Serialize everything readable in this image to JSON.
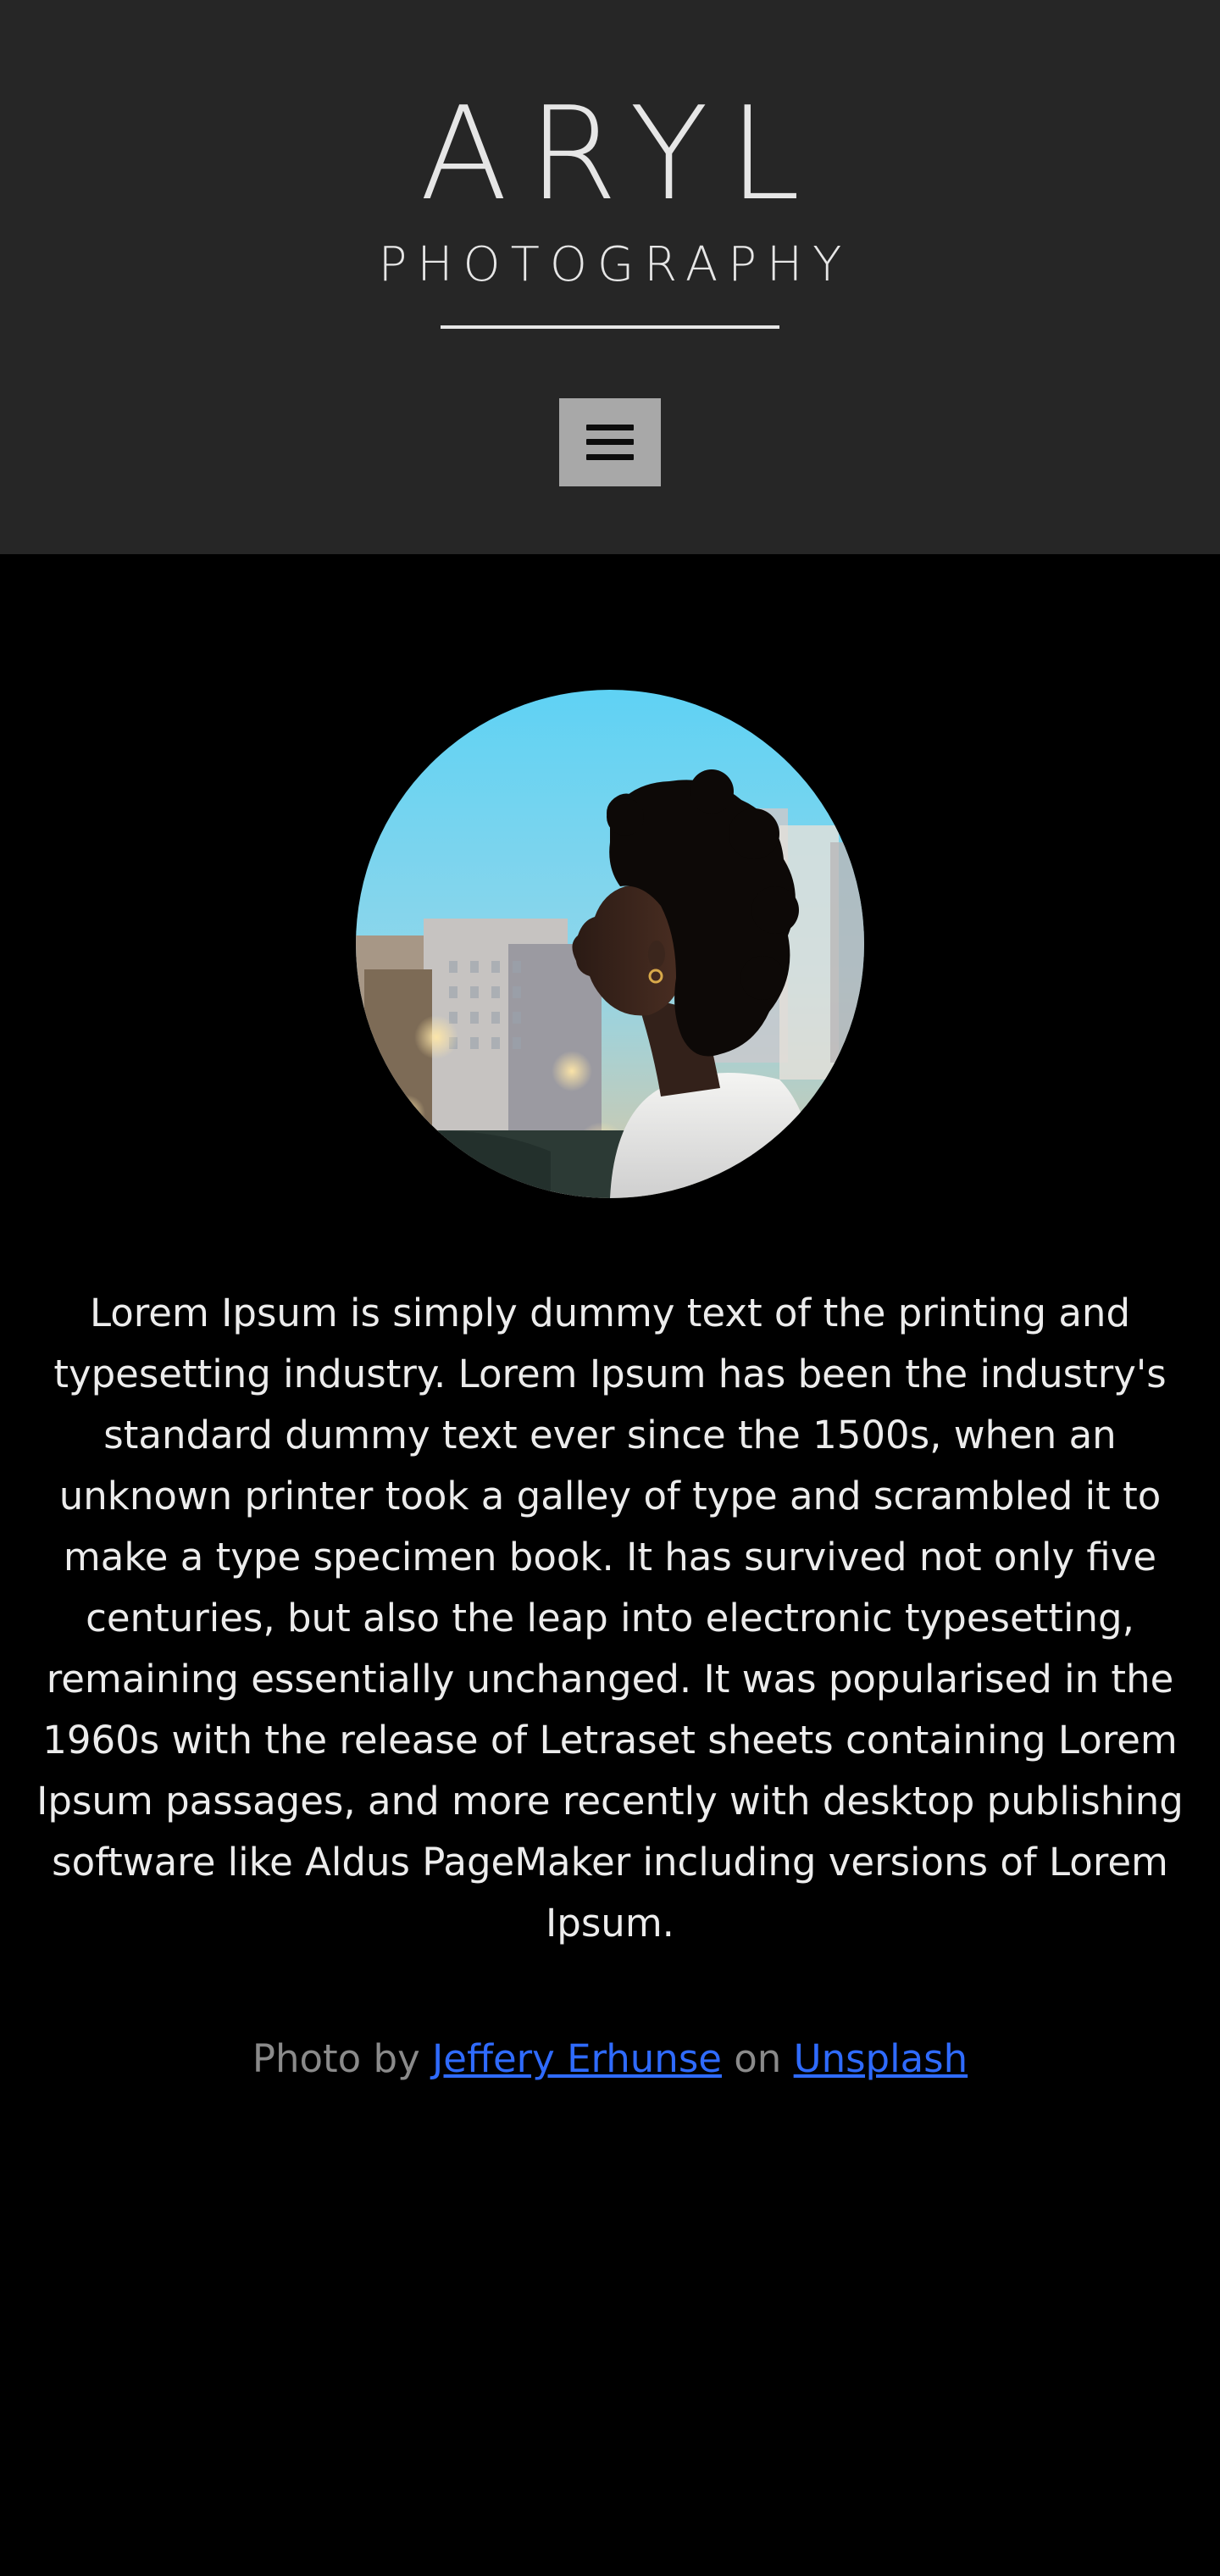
{
  "header": {
    "title": "ARYL",
    "subtitle": "PHOTOGRAPHY",
    "menu_icon": "hamburger-icon",
    "background_color": "#262626",
    "text_color": "#e6e6e6"
  },
  "main": {
    "portrait_alt": "",
    "bio": "Lorem Ipsum is simply dummy text of the printing and typesetting industry. Lorem Ipsum has been the industry's standard dummy text ever since the 1500s, when an unknown printer took a galley of type and scrambled it to make a type specimen book. It has survived not only five centuries, but also the leap into electronic typesetting, remaining essentially unchanged. It was popularised in the 1960s with the release of Letraset sheets containing Lorem Ipsum passages, and more recently with desktop publishing software like Aldus PageMaker including versions of Lorem Ipsum.",
    "background_color": "#000000"
  },
  "credit": {
    "prefix": "Photo by",
    "author": "Jeffery Erhunse",
    "middle": "on",
    "site": "Unsplash",
    "link_color": "#2f6bff"
  }
}
